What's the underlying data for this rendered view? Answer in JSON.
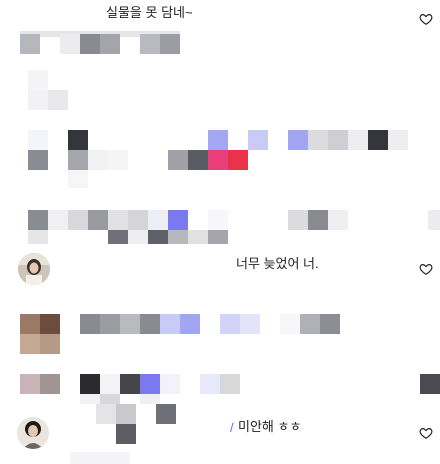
{
  "colors": {
    "accent_pink": "#e83e7a",
    "accent_red": "#e8334a",
    "accent_blue": "#7b79f0",
    "accent_lavender": "#b6b9f5",
    "dark_block": "#34363b"
  },
  "comments": [
    {
      "text": "실물을 못 담네~",
      "liked": false
    },
    {
      "text": "너무 늦었어 너.",
      "liked": false
    },
    {
      "text": "미안해 ㅎㅎ",
      "prefix": "/",
      "liked": false
    }
  ],
  "icons": {
    "like": "heart-outline-icon"
  }
}
